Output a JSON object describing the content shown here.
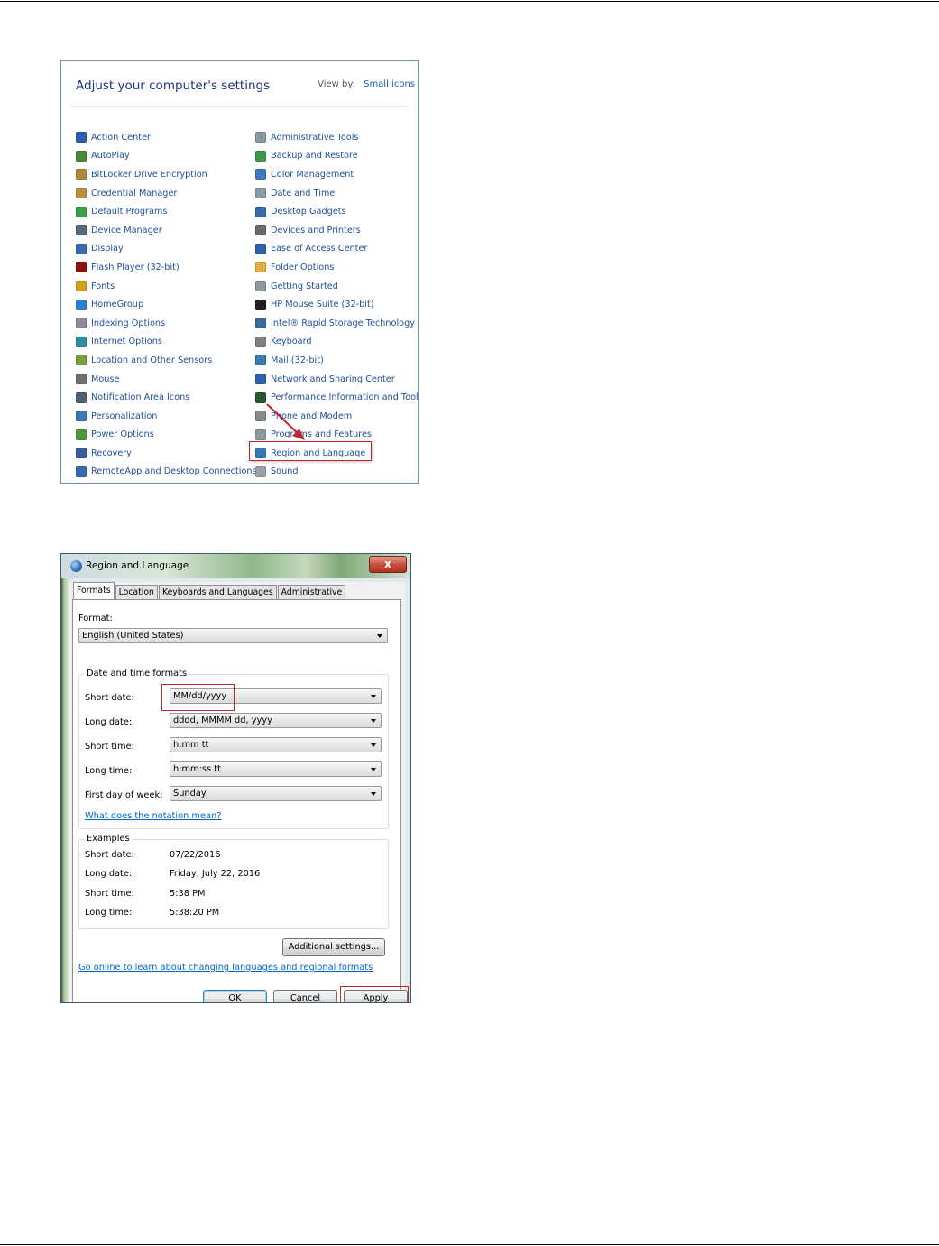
{
  "control_panel": {
    "title": "Adjust your computer's settings",
    "view_by_label": "View by:",
    "view_by_value": "Small icons",
    "left_items": [
      {
        "label": "Action Center",
        "icon": "flag-icon",
        "color": "#2f5fb0"
      },
      {
        "label": "AutoPlay",
        "icon": "autoplay-icon",
        "color": "#4a8a3a"
      },
      {
        "label": "BitLocker Drive Encryption",
        "icon": "key-icon",
        "color": "#b08a3a"
      },
      {
        "label": "Credential Manager",
        "icon": "vault-icon",
        "color": "#b89040"
      },
      {
        "label": "Default Programs",
        "icon": "default-programs-icon",
        "color": "#3aa04a"
      },
      {
        "label": "Device Manager",
        "icon": "device-manager-icon",
        "color": "#5a6a7a"
      },
      {
        "label": "Display",
        "icon": "display-icon",
        "color": "#3a6ab0"
      },
      {
        "label": "Flash Player (32-bit)",
        "icon": "flash-icon",
        "color": "#8a1010"
      },
      {
        "label": "Fonts",
        "icon": "fonts-icon",
        "color": "#d4a020"
      },
      {
        "label": "HomeGroup",
        "icon": "homegroup-icon",
        "color": "#2f7fd0"
      },
      {
        "label": "Indexing Options",
        "icon": "indexing-icon",
        "color": "#8a8a9a"
      },
      {
        "label": "Internet Options",
        "icon": "internet-icon",
        "color": "#2f8fa0"
      },
      {
        "label": "Location and Other Sensors",
        "icon": "sensors-icon",
        "color": "#7aa040"
      },
      {
        "label": "Mouse",
        "icon": "mouse-icon",
        "color": "#707070"
      },
      {
        "label": "Notification Area Icons",
        "icon": "notification-icon",
        "color": "#506070"
      },
      {
        "label": "Personalization",
        "icon": "personalization-icon",
        "color": "#3a7ab0"
      },
      {
        "label": "Power Options",
        "icon": "power-icon",
        "color": "#4a9a3a"
      },
      {
        "label": "Recovery",
        "icon": "recovery-icon",
        "color": "#3a5aa0"
      },
      {
        "label": "RemoteApp and Desktop Connections",
        "icon": "remoteapp-icon",
        "color": "#3a6ab0"
      }
    ],
    "right_items": [
      {
        "label": "Administrative Tools",
        "icon": "admin-tools-icon",
        "color": "#8a9aa0"
      },
      {
        "label": "Backup and Restore",
        "icon": "backup-icon",
        "color": "#3a9a4a"
      },
      {
        "label": "Color Management",
        "icon": "color-management-icon",
        "color": "#3a7ac0"
      },
      {
        "label": "Date and Time",
        "icon": "clock-icon",
        "color": "#8a9aa8"
      },
      {
        "label": "Desktop Gadgets",
        "icon": "gadgets-icon",
        "color": "#3a6ab0"
      },
      {
        "label": "Devices and Printers",
        "icon": "printer-icon",
        "color": "#6a6a6a"
      },
      {
        "label": "Ease of Access Center",
        "icon": "ease-of-access-icon",
        "color": "#2f5fb0"
      },
      {
        "label": "Folder Options",
        "icon": "folder-icon",
        "color": "#e0b040"
      },
      {
        "label": "Getting Started",
        "icon": "getting-started-icon",
        "color": "#8a9aa0"
      },
      {
        "label": "HP  Mouse Suite (32-bit)",
        "icon": "hp-mouse-icon",
        "color": "#202020"
      },
      {
        "label": "Intel® Rapid Storage Technology",
        "icon": "intel-storage-icon",
        "color": "#3a6a9a"
      },
      {
        "label": "Keyboard",
        "icon": "keyboard-icon",
        "color": "#808080"
      },
      {
        "label": "Mail (32-bit)",
        "icon": "mail-icon",
        "color": "#3a7ab0"
      },
      {
        "label": "Network and Sharing Center",
        "icon": "network-icon",
        "color": "#2f5fb0"
      },
      {
        "label": "Performance Information and Tools",
        "icon": "performance-icon",
        "color": "#2a5a2a"
      },
      {
        "label": "Phone and Modem",
        "icon": "phone-icon",
        "color": "#8a8a8a"
      },
      {
        "label": "Programs and Features",
        "icon": "programs-icon",
        "color": "#8a9aa0"
      },
      {
        "label": "Region and Language",
        "icon": "globe-icon",
        "color": "#3a7ab0"
      },
      {
        "label": "Sound",
        "icon": "speaker-icon",
        "color": "#9aa0a8"
      }
    ]
  },
  "dialog": {
    "title": "Region and Language",
    "close_glyph": "x",
    "tabs": [
      "Formats",
      "Location",
      "Keyboards and Languages",
      "Administrative"
    ],
    "format_label": "Format:",
    "format_value": "English (United States)",
    "date_time_group": "Date and time formats",
    "short_date_label": "Short date:",
    "short_date_value": "MM/dd/yyyy",
    "long_date_label": "Long date:",
    "long_date_value": "dddd, MMMM dd, yyyy",
    "short_time_label": "Short time:",
    "short_time_value": "h:mm tt",
    "long_time_label": "Long time:",
    "long_time_value": "h:mm:ss tt",
    "first_day_label": "First day of week:",
    "first_day_value": "Sunday",
    "notation_link": "What does the notation mean?",
    "examples_group": "Examples",
    "ex_short_date_label": "Short date:",
    "ex_short_date_value": "07/22/2016",
    "ex_long_date_label": "Long date:",
    "ex_long_date_value": "Friday, July 22, 2016",
    "ex_short_time_label": "Short time:",
    "ex_short_time_value": "5:38 PM",
    "ex_long_time_label": "Long time:",
    "ex_long_time_value": "5:38:20 PM",
    "additional_settings": "Additional settings...",
    "online_link": "Go online to learn about changing languages and regional formats",
    "ok": "OK",
    "cancel": "Cancel",
    "apply": "Apply"
  },
  "colors": {
    "highlight": "#c0252b",
    "link": "#1f4e9a"
  }
}
